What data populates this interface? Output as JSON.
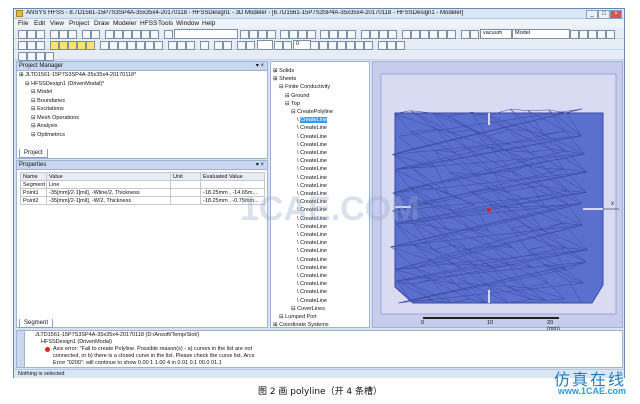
{
  "window": {
    "title": "ANSYS HFSS - 8.7D1561-15P7S3SP4A-35x35x4-20170118 - HFSSDesign1 - 3D Modeler - [6.7D1561-15P7S3SP4A-35x35x4-20170118 - HFSSDesign1 - Modeler]"
  },
  "menu": [
    "File",
    "Edit",
    "View",
    "Project",
    "Draw",
    "Modeler",
    "HFSS",
    "Tools",
    "Window",
    "Help"
  ],
  "toolbar": {
    "model_select": "Model",
    "vacuum_select": "vacuum",
    "value_select": "0"
  },
  "project_manager": {
    "title": "Project Manager",
    "items": [
      {
        "label": "JLTD1561-15P7S3SP4A-35x35x4-20170118*",
        "indent": 0
      },
      {
        "label": "HFSSDesign1 (DrivenModal)*",
        "indent": 1
      },
      {
        "label": "Model",
        "indent": 2
      },
      {
        "label": "Boundaries",
        "indent": 2
      },
      {
        "label": "Excitations",
        "indent": 2
      },
      {
        "label": "Mesh Operations",
        "indent": 2
      },
      {
        "label": "Analysis",
        "indent": 2
      },
      {
        "label": "Optimetrics",
        "indent": 2
      }
    ],
    "tab": "Project"
  },
  "properties": {
    "title": "Properties",
    "columns": [
      "Name",
      "Value",
      "Unit",
      "Evaluated Value"
    ],
    "rows": [
      [
        "Segment",
        "Line",
        "",
        ""
      ],
      [
        "Point1",
        "-35[mm]/2-1[mil], -Wline/2, Thickness",
        "",
        "-18.25mm , -14.65m..."
      ],
      [
        "Point2",
        "-35[mm]/2-1[mil], -W/2, Thickness",
        "",
        "-18.25mm , -0.75mm..."
      ]
    ],
    "tab": "Segment"
  },
  "model_tree": {
    "items": [
      {
        "label": "Solids",
        "indent": 0
      },
      {
        "label": "Sheets",
        "indent": 0
      },
      {
        "label": "Finite Conductivity",
        "indent": 1
      },
      {
        "label": "Ground",
        "indent": 2
      },
      {
        "label": "Top",
        "indent": 2
      },
      {
        "label": "CreatePolyline",
        "indent": 3
      },
      {
        "label": "CreateLine",
        "indent": 4,
        "selected": true
      },
      {
        "label": "CreateLine",
        "indent": 4
      },
      {
        "label": "CreateLine",
        "indent": 4
      },
      {
        "label": "CreateLine",
        "indent": 4
      },
      {
        "label": "CreateLine",
        "indent": 4
      },
      {
        "label": "CreateLine",
        "indent": 4
      },
      {
        "label": "CreateLine",
        "indent": 4
      },
      {
        "label": "CreateLine",
        "indent": 4
      },
      {
        "label": "CreateLine",
        "indent": 4
      },
      {
        "label": "CreateLine",
        "indent": 4
      },
      {
        "label": "CreateLine",
        "indent": 4
      },
      {
        "label": "CreateLine",
        "indent": 4
      },
      {
        "label": "CreateLine",
        "indent": 4
      },
      {
        "label": "CreateLine",
        "indent": 4
      },
      {
        "label": "CreateLine",
        "indent": 4
      },
      {
        "label": "CreateLine",
        "indent": 4
      },
      {
        "label": "CreateLine",
        "indent": 4
      },
      {
        "label": "CreateLine",
        "indent": 4
      },
      {
        "label": "CreateLine",
        "indent": 4
      },
      {
        "label": "CreateLine",
        "indent": 4
      },
      {
        "label": "CreateLine",
        "indent": 4
      },
      {
        "label": "CreateLine",
        "indent": 4
      },
      {
        "label": "CreateLine",
        "indent": 4
      },
      {
        "label": "CoverLines",
        "indent": 3
      },
      {
        "label": "Lumped Port",
        "indent": 1
      },
      {
        "label": "Coordinate Systems",
        "indent": 0
      }
    ]
  },
  "scale": {
    "labels": [
      "0",
      "10",
      "20 (mm)"
    ]
  },
  "messages": {
    "lines": [
      "JLTD1561-15P7S3SP4A-35x35x4-20170118 (D:/Ansoft/Temp/Slot/)",
      "HFSSDesign1 (DrivenModal)",
      "Axis error: \"Fail to create Polyline. Possible reason(s) - a) curves in the list are not",
      "connected, or b) there is a closed curve in the list. Please check the curve list. Arcs",
      "Error \"0200\": will continue to show 0.00 1 1.00 4 in 0.01 0.1 00.0 01.1"
    ]
  },
  "status": "Nothing is selected",
  "figure_caption": "图 2  画 polyline（开 4 条槽）",
  "watermark": "1CAE.COM",
  "logo": {
    "cn": "仿真在线",
    "en": "www.1CAE.com"
  },
  "colors": {
    "mesh_fill": "#5b6fcf",
    "mesh_line": "#3b4aa0",
    "viewport_bg": "#c7ccec",
    "accent": "#1f7dc4"
  }
}
